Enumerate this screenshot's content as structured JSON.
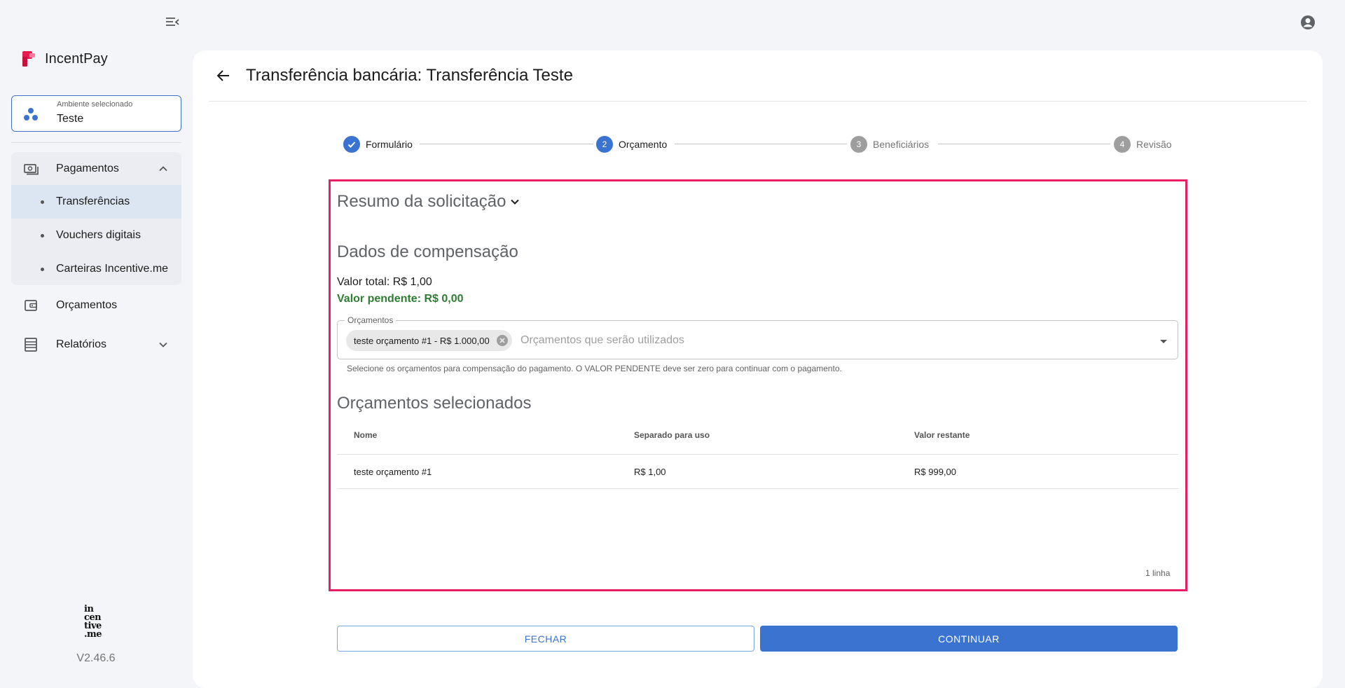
{
  "app": {
    "name": "IncentPay",
    "version": "V2.46.6"
  },
  "environment": {
    "caption": "Ambiente selecionado",
    "value": "Teste"
  },
  "sidebar": {
    "payments": {
      "label": "Pagamentos",
      "items": [
        {
          "label": "Transferências",
          "active": true
        },
        {
          "label": "Vouchers digitais",
          "active": false
        },
        {
          "label": "Carteiras Incentive.me",
          "active": false
        }
      ]
    },
    "budgets": {
      "label": "Orçamentos"
    },
    "reports": {
      "label": "Relatórios"
    }
  },
  "footer_logo": {
    "line1": "in",
    "line2": "cen",
    "line3": "tive",
    "line4": ".me"
  },
  "page": {
    "title": "Transferência bancária: Transferência Teste"
  },
  "stepper": {
    "steps": [
      {
        "number": "1",
        "label": "Formulário",
        "state": "done"
      },
      {
        "number": "2",
        "label": "Orçamento",
        "state": "current"
      },
      {
        "number": "3",
        "label": "Beneficiários",
        "state": "pending"
      },
      {
        "number": "4",
        "label": "Revisão",
        "state": "pending"
      }
    ]
  },
  "summary": {
    "label": "Resumo da solicitação"
  },
  "compensation": {
    "heading": "Dados de compensação",
    "total": "Valor total: R$ 1,00",
    "pending": "Valor pendente: R$ 0,00",
    "pending_color": "#2e7d32",
    "select": {
      "legend": "Orçamentos",
      "chip": "teste orçamento #1 - R$ 1.000,00",
      "placeholder": "Orçamentos que serão utilizados",
      "helper": "Selecione os orçamentos para compensação do pagamento. O VALOR PENDENTE deve ser zero para continuar com o pagamento."
    }
  },
  "selected_budgets": {
    "heading": "Orçamentos selecionados",
    "columns": [
      "Nome",
      "Separado para uso",
      "Valor restante"
    ],
    "rows": [
      [
        "teste orçamento #1",
        "R$ 1,00",
        "R$ 999,00"
      ]
    ],
    "footer": "1 linha"
  },
  "actions": {
    "close": "FECHAR",
    "continue": "CONTINUAR"
  },
  "colors": {
    "accent": "#3b73d1",
    "highlight": "#e91e63"
  }
}
